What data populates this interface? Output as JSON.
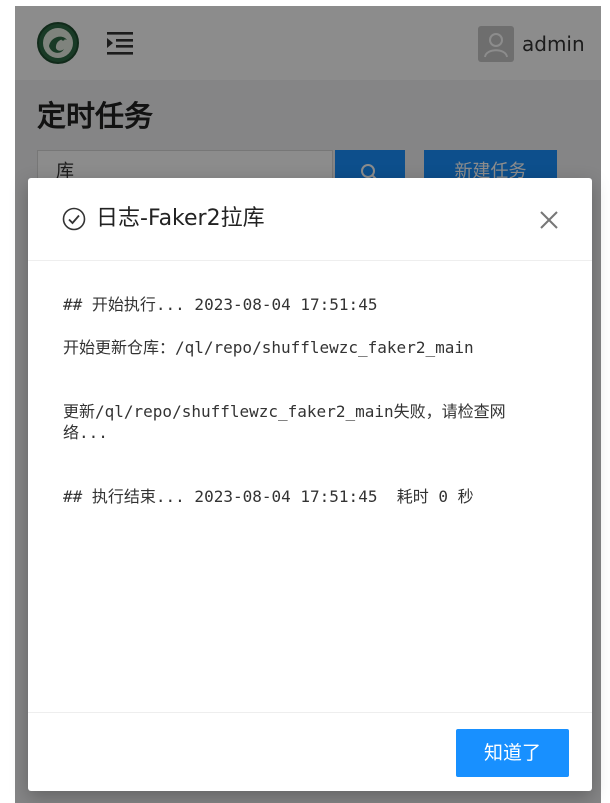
{
  "header": {
    "username": "admin",
    "logo_icon": "dragon-logo-icon",
    "menu_icon": "menu-unfold-icon",
    "avatar_icon": "user-avatar-icon"
  },
  "page": {
    "title": "定时任务",
    "search_value": "库",
    "search_icon": "search-icon",
    "new_task_label": "新建任务"
  },
  "modal": {
    "title": "日志-Faker2拉库",
    "title_icon": "check-circle-icon",
    "close_icon": "close-icon",
    "log_lines": [
      "## 开始执行... 2023-08-04 17:51:45",
      "开始更新仓库：/ql/repo/shufflewzc_faker2_main",
      "更新/ql/repo/shufflewzc_faker2_main失败，请检查网络...",
      "## 执行结束... 2023-08-04 17:51:45  耗时 0 秒"
    ],
    "ok_label": "知道了"
  },
  "colors": {
    "primary": "#1890ff",
    "overlay": "rgba(0,0,0,0.45)"
  }
}
